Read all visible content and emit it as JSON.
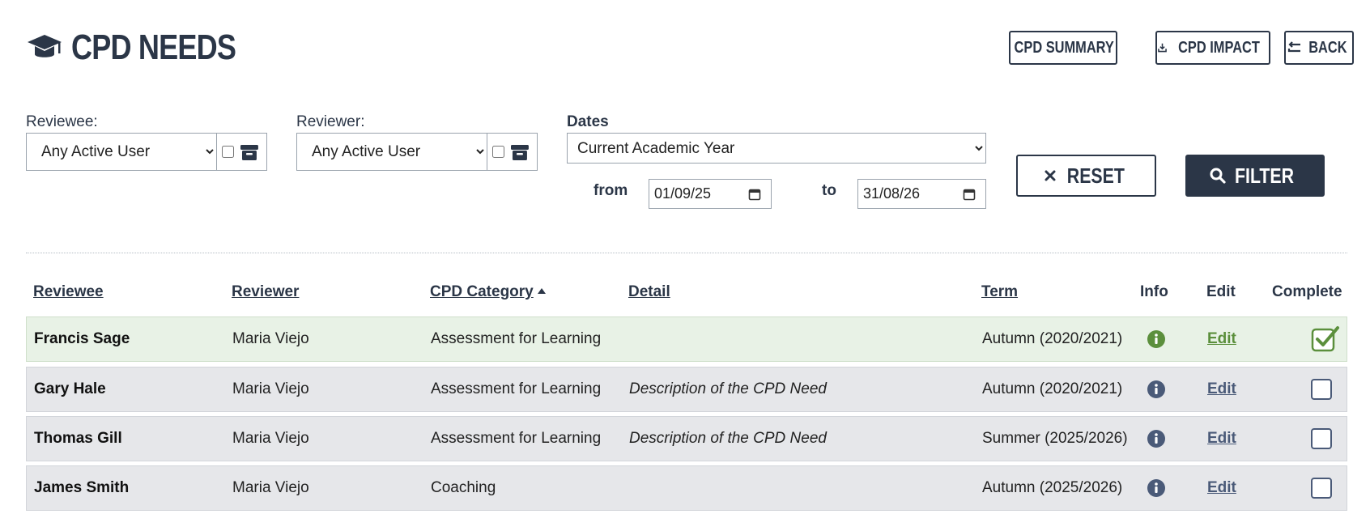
{
  "header": {
    "title": "CPD NEEDS",
    "icon": "graduation-cap-icon",
    "buttons": {
      "cpd_summary": "CPD SUMMARY",
      "cpd_impact": "CPD IMPACT",
      "back": "BACK"
    }
  },
  "filters": {
    "reviewee_label": "Reviewee:",
    "reviewee_value": "Any Active User",
    "reviewer_label": "Reviewer:",
    "reviewer_value": "Any Active User",
    "dates_label": "Dates",
    "dates_value": "Current Academic Year",
    "from_label": "from",
    "from_value": "01/09/25",
    "to_label": "to",
    "to_value": "31/08/26",
    "reset_label": "RESET",
    "filter_label": "FILTER"
  },
  "table": {
    "columns": {
      "reviewee": "Reviewee",
      "reviewer": "Reviewer",
      "category": "CPD Category",
      "detail": "Detail",
      "term": "Term",
      "info": "Info",
      "edit": "Edit",
      "complete": "Complete"
    },
    "sort": {
      "column": "CPD Category",
      "direction": "ascending"
    },
    "rows": [
      {
        "reviewee": "Francis Sage",
        "reviewer": "Maria Viejo",
        "category": "Assessment for Learning",
        "detail": "",
        "term": "Autumn (2020/2021)",
        "edit": "Edit",
        "complete": true
      },
      {
        "reviewee": "Gary Hale",
        "reviewer": "Maria Viejo",
        "category": "Assessment for Learning",
        "detail": "Description of the CPD Need",
        "term": "Autumn (2020/2021)",
        "edit": "Edit",
        "complete": false
      },
      {
        "reviewee": "Thomas Gill",
        "reviewer": "Maria Viejo",
        "category": "Assessment for Learning",
        "detail": "Description of the CPD Need",
        "term": "Summer (2025/2026)",
        "edit": "Edit",
        "complete": false
      },
      {
        "reviewee": "James Smith",
        "reviewer": "Maria Viejo",
        "category": "Coaching",
        "detail": "",
        "term": "Autumn (2025/2026)",
        "edit": "Edit",
        "complete": false
      }
    ]
  },
  "colors": {
    "primary": "#2b3647",
    "complete_green": "#5b8f3c",
    "row_bg": "#e6e7ea",
    "row_complete_bg": "#e8f2e6"
  }
}
